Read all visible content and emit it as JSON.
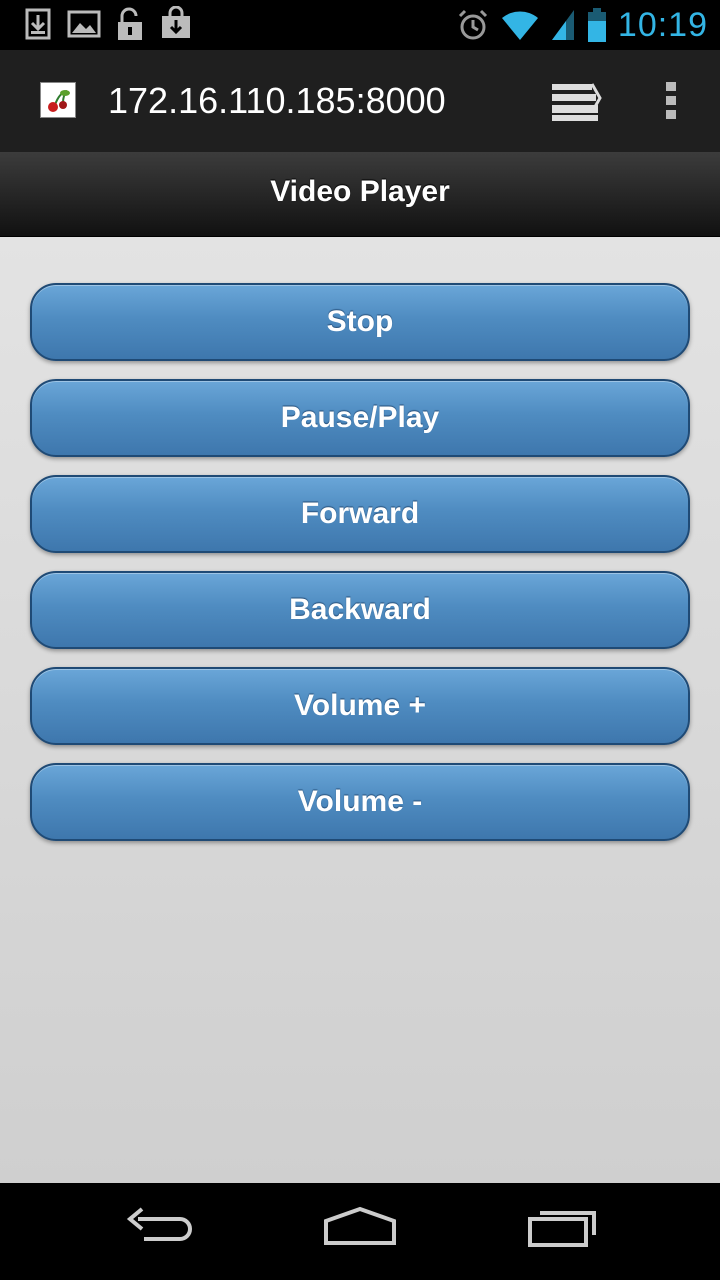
{
  "status_bar": {
    "time": "10:19",
    "left_icons": [
      "download-notification-icon",
      "image-notification-icon",
      "unlock-notification-icon",
      "store-download-notification-icon"
    ],
    "right_icons": [
      "alarm-icon",
      "wifi-icon",
      "signal-icon",
      "battery-icon"
    ],
    "accent_color": "#33b5e5"
  },
  "browser": {
    "url": "172.16.110.185:8000",
    "favicon": "cherry-favicon-icon"
  },
  "app": {
    "title": "Video Player"
  },
  "buttons": [
    {
      "label": "Stop"
    },
    {
      "label": "Pause/Play"
    },
    {
      "label": "Forward"
    },
    {
      "label": "Backward"
    },
    {
      "label": "Volume +"
    },
    {
      "label": "Volume -"
    }
  ],
  "nav": {
    "icons": [
      "back-icon",
      "home-icon",
      "recent-apps-icon"
    ]
  },
  "colors": {
    "button_top": "#6aa6d8",
    "button_bottom": "#3e77ad",
    "button_border": "#1f4a75",
    "header_dark": "#111111"
  }
}
